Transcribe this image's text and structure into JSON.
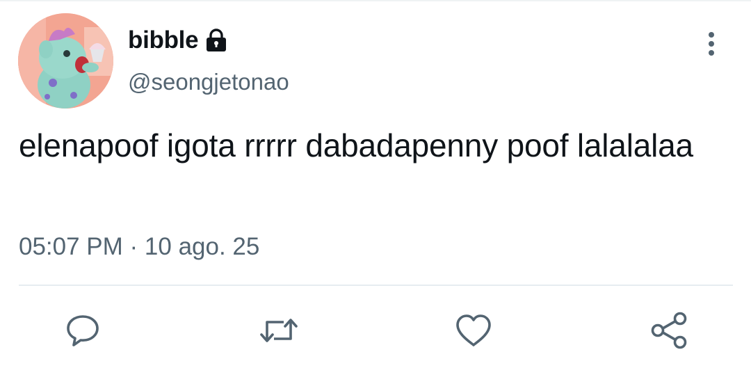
{
  "tweet": {
    "author": {
      "display_name": "bibble",
      "handle": "@seongjetonao",
      "protected": true,
      "avatar_icon": "avatar-bibble"
    },
    "text": "elenapoof igota rrrrr dabadapenny poof lalalalaa",
    "timestamp": "05:07 PM · 10 ago. 25"
  },
  "actions": [
    {
      "name": "reply",
      "icon": "speech-bubble-icon"
    },
    {
      "name": "retweet",
      "icon": "retweet-icon"
    },
    {
      "name": "like",
      "icon": "heart-icon"
    },
    {
      "name": "share",
      "icon": "share-icon"
    }
  ],
  "colors": {
    "primary_text": "#0f1419",
    "secondary_text": "#536471",
    "icon": "#536471",
    "divider": "#e6ecf0"
  }
}
